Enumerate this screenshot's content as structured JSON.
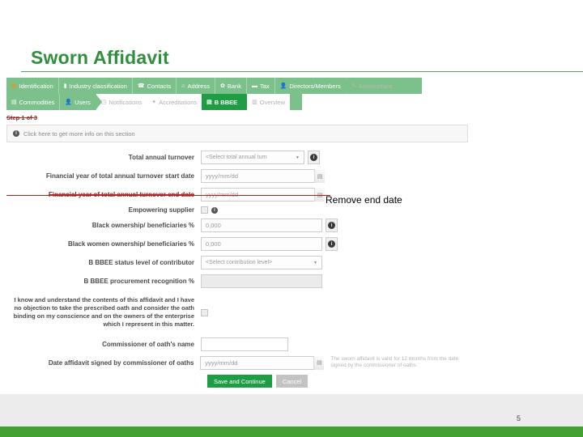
{
  "slide": {
    "title": "Sworn Affidavit",
    "page_number": "5",
    "accent_green": "#2f8f3e",
    "active_tab_green": "#1f9d45",
    "tab_bar_green": "#7cc08c",
    "footer_green": "#45a033"
  },
  "tabs": {
    "row1": [
      {
        "label": "Identification",
        "icon": "grid-icon",
        "state": "normal"
      },
      {
        "label": "Industry classification",
        "icon": "briefcase-icon",
        "state": "normal"
      },
      {
        "label": "Contacts",
        "icon": "phone-icon",
        "state": "normal"
      },
      {
        "label": "Address",
        "icon": "home-icon",
        "state": "normal"
      },
      {
        "label": "Bank",
        "icon": "bank-icon",
        "state": "normal"
      },
      {
        "label": "Tax",
        "icon": "card-icon",
        "state": "normal"
      },
      {
        "label": "Directors/Members",
        "icon": "user-icon",
        "state": "normal"
      },
      {
        "label": "Associations",
        "icon": "pencil-icon",
        "state": "inactive"
      }
    ],
    "row2": [
      {
        "label": "Commodities",
        "icon": "monitor-icon",
        "state": "normal"
      },
      {
        "label": "Users",
        "icon": "user-icon",
        "state": "normal"
      },
      {
        "label": "Notifications",
        "icon": "bell-icon",
        "state": "inactive"
      },
      {
        "label": "Accreditations",
        "icon": "badge-icon",
        "state": "inactive"
      },
      {
        "label": "B BBEE",
        "icon": "monitor-icon",
        "state": "active"
      },
      {
        "label": "Overview",
        "icon": "list-icon",
        "state": "inactive"
      }
    ]
  },
  "step_label": "Step 1 of 3",
  "info_banner": {
    "icon": "info-icon",
    "text": "Click here to get more info on this section"
  },
  "form": {
    "fields": [
      {
        "label": "Total annual turnover",
        "control": "select",
        "value": "<Select total annual turn",
        "has_help": true,
        "struck": false
      },
      {
        "label": "Financial year of total annual turnover start date",
        "control": "date",
        "value": "yyyy/mm/dd",
        "has_help": false,
        "struck": false
      },
      {
        "label": "Financial year of total annual turnover end date",
        "control": "date",
        "value": "yyyy/mm/dd",
        "has_help": false,
        "struck": true
      },
      {
        "label": "Empowering supplier",
        "control": "checkbox",
        "value": "",
        "has_help": true,
        "struck": false
      },
      {
        "label": "Black ownership/ beneficiaries %",
        "control": "text",
        "value": "0,000",
        "has_help": true,
        "struck": false
      },
      {
        "label": "Black women ownership/ beneficiaries %",
        "control": "text",
        "value": "0,000",
        "has_help": true,
        "struck": false
      },
      {
        "label": "B BBEE status level of contributor",
        "control": "select-wide",
        "value": "<Select contribution level>",
        "has_help": false,
        "struck": false
      },
      {
        "label": "B BBEE procurement recognition %",
        "control": "text-disabled",
        "value": "",
        "has_help": false,
        "struck": false
      }
    ],
    "affidavit_statement": "I know and understand the contents of this affidavit and I have no objection to take the prescribed oath and consider the oath binding on my conscience and on the owners of the enterprise which I represent in this matter.",
    "commissioner_name": {
      "label": "Commissioner of oath's name",
      "value": ""
    },
    "commissioner_date": {
      "label": "Date affidavit signed by commissioner of oaths",
      "value": "yyyy/mm/dd",
      "help_text": "The sworn affidavit is valid for 12 months from the date signed by the commissioner of oaths."
    },
    "buttons": {
      "save": "Save and Continue",
      "cancel": "Cancel"
    }
  },
  "annotation": {
    "remove_end_date": "Remove end date"
  }
}
